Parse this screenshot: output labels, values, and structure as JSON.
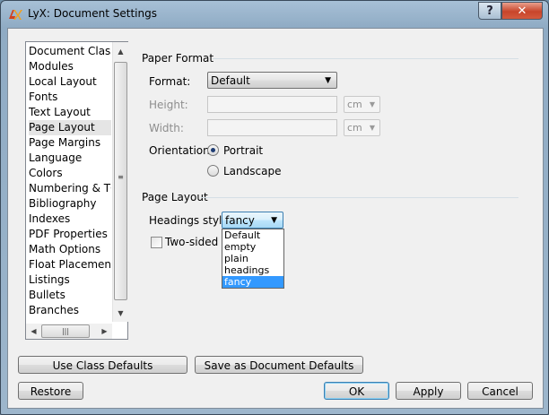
{
  "window": {
    "title": "LyX: Document Settings",
    "help_label": "?",
    "close_label": "✕"
  },
  "sidebar": {
    "items": [
      {
        "label": "Document Class"
      },
      {
        "label": "Modules"
      },
      {
        "label": "Local Layout"
      },
      {
        "label": "Fonts"
      },
      {
        "label": "Text Layout"
      },
      {
        "label": "Page Layout"
      },
      {
        "label": "Page Margins"
      },
      {
        "label": "Language"
      },
      {
        "label": "Colors"
      },
      {
        "label": "Numbering & TO"
      },
      {
        "label": "Bibliography"
      },
      {
        "label": "Indexes"
      },
      {
        "label": "PDF Properties"
      },
      {
        "label": "Math Options"
      },
      {
        "label": "Float Placement"
      },
      {
        "label": "Listings"
      },
      {
        "label": "Bullets"
      },
      {
        "label": "Branches"
      }
    ],
    "selected": "Page Layout"
  },
  "paper_format": {
    "section_label": "Paper Format",
    "format_label": "Format:",
    "format_value": "Default",
    "height_label": "Height:",
    "height_unit": "cm",
    "width_label": "Width:",
    "width_unit": "cm",
    "orientation_label": "Orientation:",
    "portrait_label": "Portrait",
    "landscape_label": "Landscape",
    "orientation_selected": "Portrait"
  },
  "page_layout": {
    "section_label": "Page Layout",
    "headings_label": "Headings style:",
    "headings_value": "fancy",
    "headings_options": [
      "Default",
      "empty",
      "plain",
      "headings",
      "fancy"
    ],
    "two_sided_label": "Two-sided do"
  },
  "buttons": {
    "use_class_defaults": "Use Class Defaults",
    "save_defaults": "Save as Document Defaults",
    "restore": "Restore",
    "ok": "OK",
    "apply": "Apply",
    "cancel": "Cancel"
  },
  "colors": {
    "accent": "#3399ff",
    "selection_bg": "#e5e5e5",
    "close_button": "#c8452b"
  }
}
